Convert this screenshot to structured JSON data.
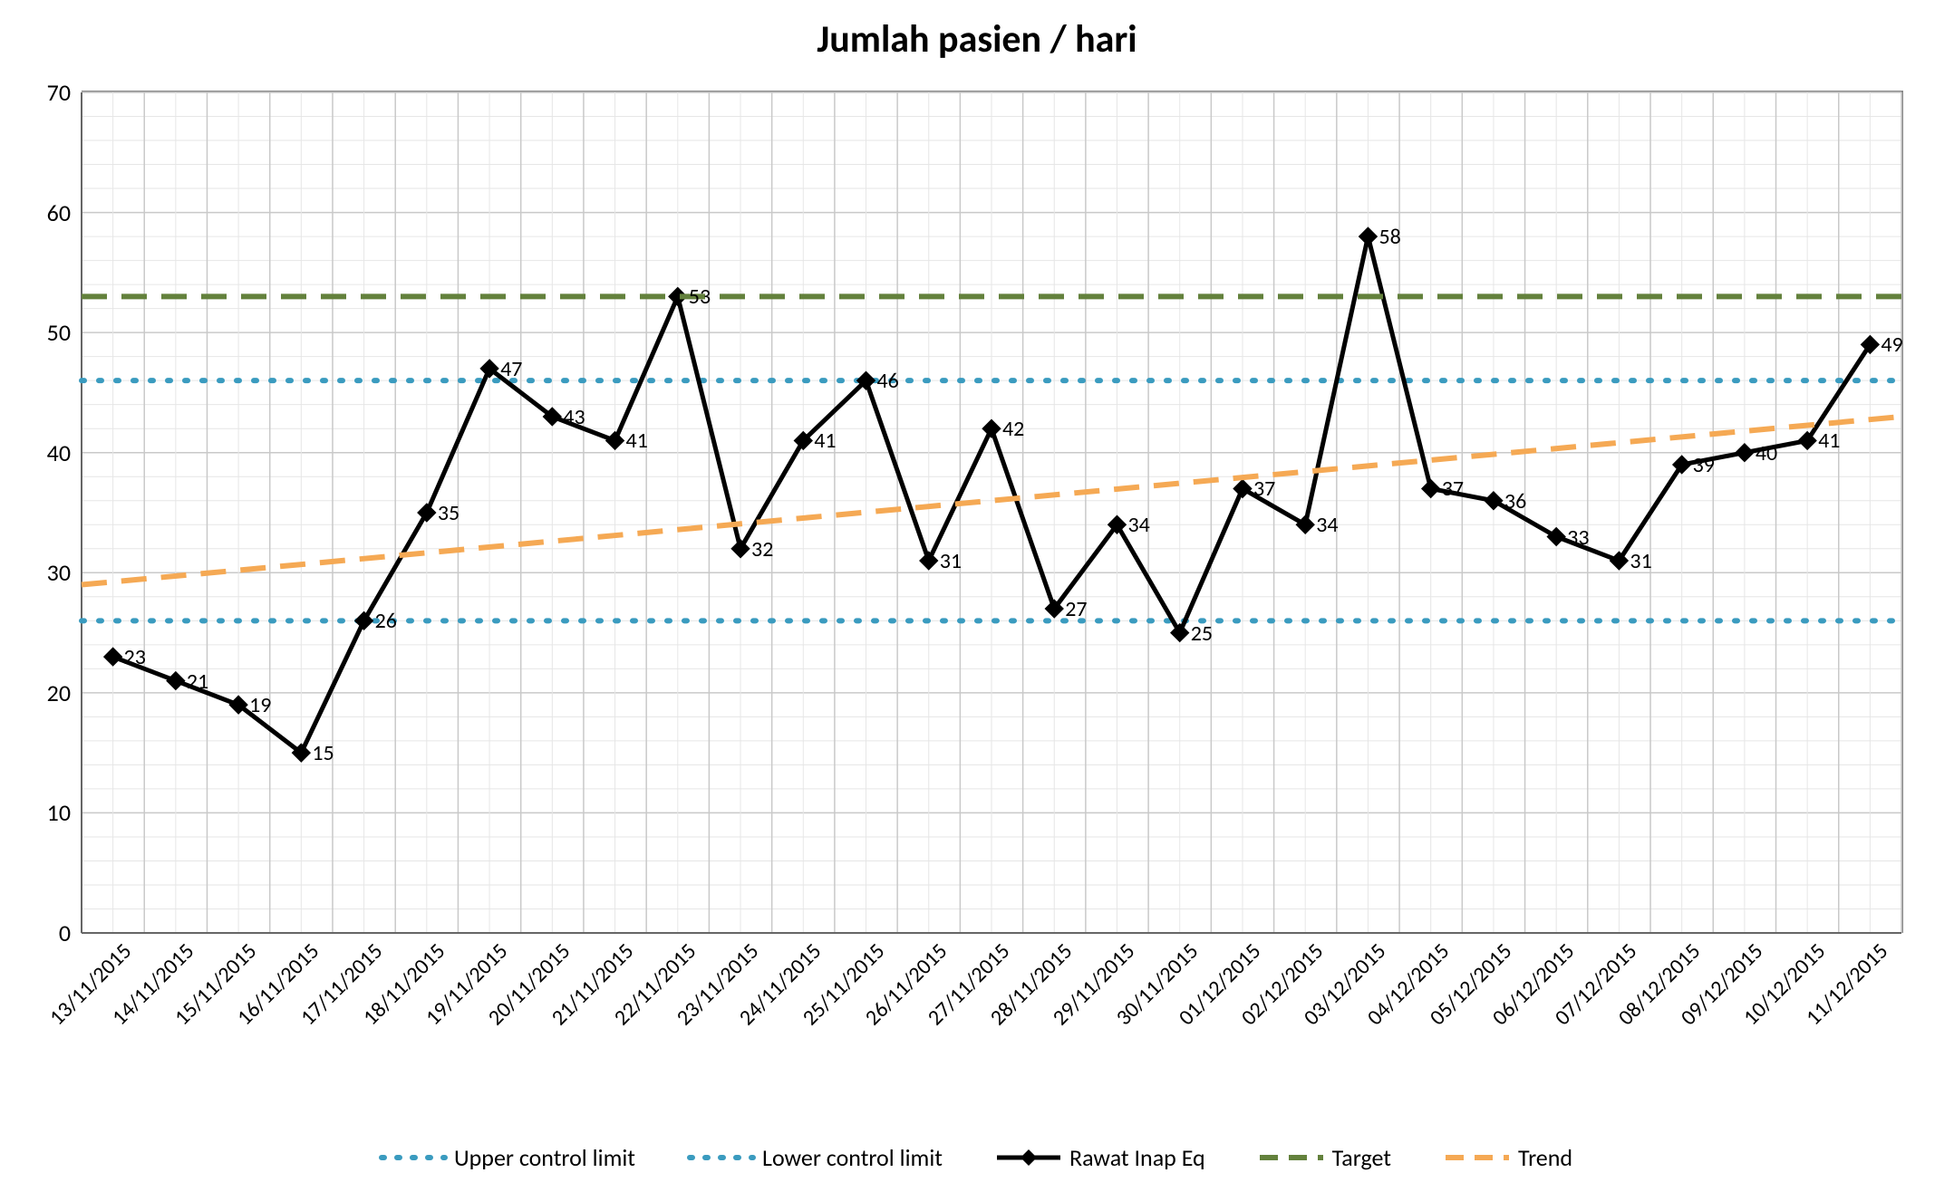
{
  "chart_data": {
    "type": "line",
    "title": "Jumlah pasien / hari",
    "xlabel": "",
    "ylabel": "",
    "ylim": [
      0,
      70
    ],
    "yticks": [
      0,
      10,
      20,
      30,
      40,
      50,
      60,
      70
    ],
    "categories": [
      "13/11/2015",
      "14/11/2015",
      "15/11/2015",
      "16/11/2015",
      "17/11/2015",
      "18/11/2015",
      "19/11/2015",
      "20/11/2015",
      "21/11/2015",
      "22/11/2015",
      "23/11/2015",
      "24/11/2015",
      "25/11/2015",
      "26/11/2015",
      "27/11/2015",
      "28/11/2015",
      "29/11/2015",
      "30/11/2015",
      "01/12/2015",
      "02/12/2015",
      "03/12/2015",
      "04/12/2015",
      "05/12/2015",
      "06/12/2015",
      "07/12/2015",
      "08/12/2015",
      "09/12/2015",
      "10/12/2015",
      "11/12/2015"
    ],
    "series": [
      {
        "name": "Upper control limit",
        "type": "dotted",
        "color": "#3a9bbf",
        "constant": 46
      },
      {
        "name": "Lower control limit",
        "type": "dotted",
        "color": "#3a9bbf",
        "constant": 26
      },
      {
        "name": "Rawat Inap Eq",
        "type": "line-marker",
        "color": "#000000",
        "values": [
          23,
          21,
          19,
          15,
          26,
          35,
          47,
          43,
          41,
          53,
          32,
          41,
          46,
          31,
          42,
          27,
          34,
          25,
          37,
          34,
          58,
          37,
          36,
          33,
          31,
          39,
          40,
          41,
          49
        ]
      },
      {
        "name": "Target",
        "type": "dashed",
        "color": "#63813c",
        "constant": 53
      },
      {
        "name": "Trend",
        "type": "dashed",
        "color": "#f5a954",
        "trend_start": 29,
        "trend_end": 43
      }
    ],
    "grid": {
      "minor_x_per_major": 2,
      "minor_y_per_major": 5
    },
    "legend_position": "bottom"
  }
}
